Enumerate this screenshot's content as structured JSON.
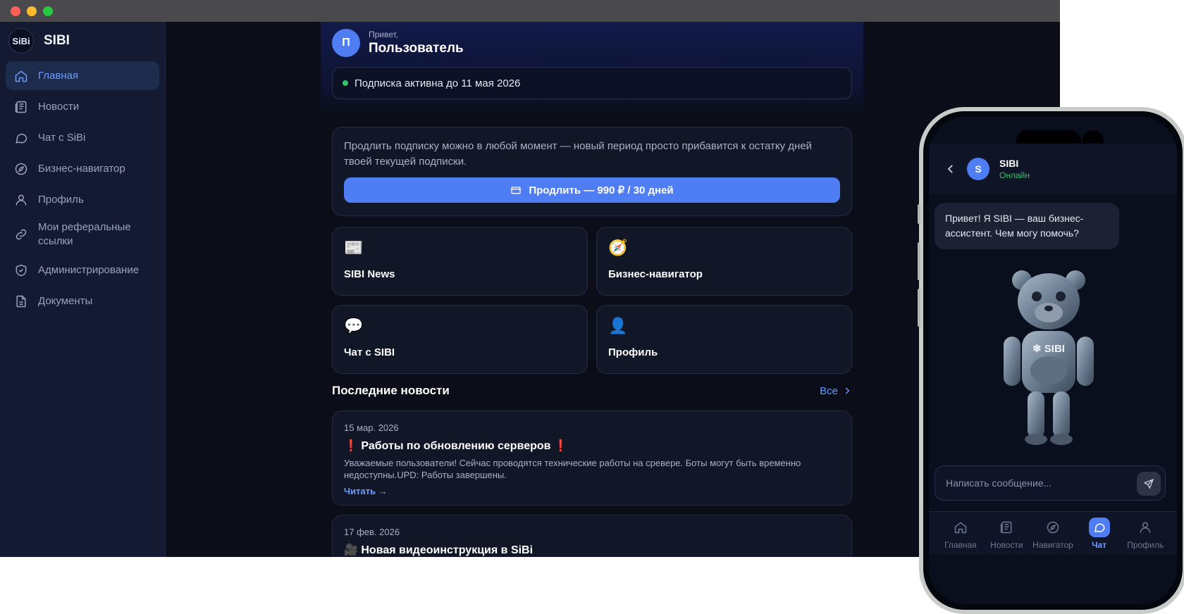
{
  "app": {
    "brand_name": "SIBI",
    "logo_text": "SiBi"
  },
  "sidebar": {
    "items": [
      {
        "label": "Главная",
        "icon": "home-icon",
        "active": true
      },
      {
        "label": "Новости",
        "icon": "newspaper-icon"
      },
      {
        "label": "Чат с SiBi",
        "icon": "chat-icon"
      },
      {
        "label": "Бизнес-навигатор",
        "icon": "compass-icon"
      },
      {
        "label": "Профиль",
        "icon": "user-icon"
      },
      {
        "label": "Мои реферальные ссылки",
        "icon": "link-icon"
      },
      {
        "label": "Администрирование",
        "icon": "shield-icon"
      },
      {
        "label": "Документы",
        "icon": "document-icon"
      }
    ]
  },
  "header": {
    "avatar_letter": "П",
    "greeting": "Привет,",
    "user_name": "Пользователь",
    "subscription_status": "Подписка активна до 11 мая 2026"
  },
  "renew": {
    "text": "Продлить подписку можно в любой момент — новый период просто прибавится к остатку дней твоей текущей подписки.",
    "button_label": "Продлить — 990 ₽ / 30 дней"
  },
  "tiles": [
    {
      "emoji": "📰",
      "label": "SIBI News",
      "icon": "newspaper-emoji-icon"
    },
    {
      "emoji": "🧭",
      "label": "Бизнес-навигатор",
      "icon": "compass-emoji-icon"
    },
    {
      "emoji": "💬",
      "label": "Чат с SIBI",
      "icon": "speech-bubble-emoji-icon"
    },
    {
      "emoji": "👤",
      "label": "Профиль",
      "icon": "user-emoji-icon"
    }
  ],
  "news_section": {
    "title": "Последние новости",
    "all_label": "Все"
  },
  "news": [
    {
      "date": "15 мар. 2026",
      "title": "❗ Работы по обновлению серверов ❗",
      "text": "Уважаемые пользователи! Сейчас проводятся технические работы на сревере. Боты могут быть временно недоступны.UPD: Работы завершены.",
      "read_label": "Читать →"
    },
    {
      "date": "17 фев. 2026",
      "title": "🎥 Новая видеоинструкция в SiBi"
    }
  ],
  "phone": {
    "avatar_letter": "S",
    "chat_name": "SIBI",
    "chat_status": "Онлайн",
    "bot_message": "Привет! Я SIBI — ваш бизнес-ассистент. Чем могу помочь?",
    "mascot_label": "❄ SIBI",
    "input_placeholder": "Написать сообщение...",
    "tabs": [
      {
        "label": "Главная",
        "icon": "home-icon"
      },
      {
        "label": "Новости",
        "icon": "newspaper-icon"
      },
      {
        "label": "Навигатор",
        "icon": "compass-icon"
      },
      {
        "label": "Чат",
        "icon": "chat-icon",
        "active": true
      },
      {
        "label": "Профиль",
        "icon": "user-icon"
      }
    ]
  },
  "colors": {
    "accent": "#4f7df3",
    "accent_text": "#6d9bff",
    "online": "#35c46a",
    "background": "#0b0e19",
    "sidebar": "#141a31"
  }
}
